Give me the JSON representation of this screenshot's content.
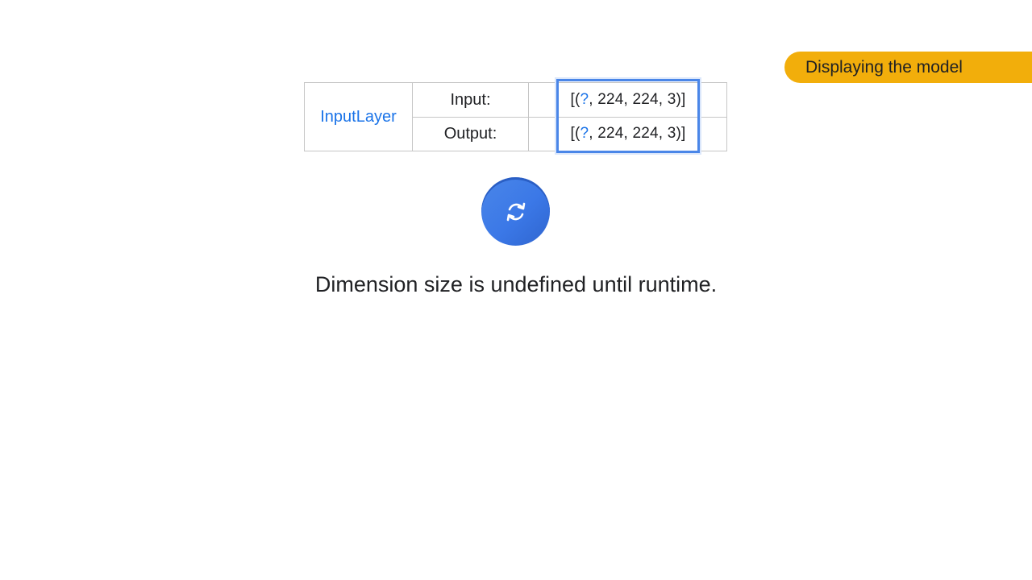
{
  "badge": {
    "label": "Displaying the model"
  },
  "table": {
    "layer_name": "InputLayer",
    "input_label": "Input:",
    "output_label": "Output:",
    "input_value": {
      "open": "[(",
      "unknown": "?",
      "rest": ", 224, 224, 3)]"
    },
    "output_value": {
      "open": "[(",
      "unknown": "?",
      "rest": ", 224, 224, 3)]"
    }
  },
  "caption": "Dimension size is undefined until runtime.",
  "colors": {
    "accent": "#1a73e8",
    "badge": "#f2ae0b",
    "highlight": "#4a86e8"
  },
  "icons": {
    "refresh": "refresh-icon"
  }
}
